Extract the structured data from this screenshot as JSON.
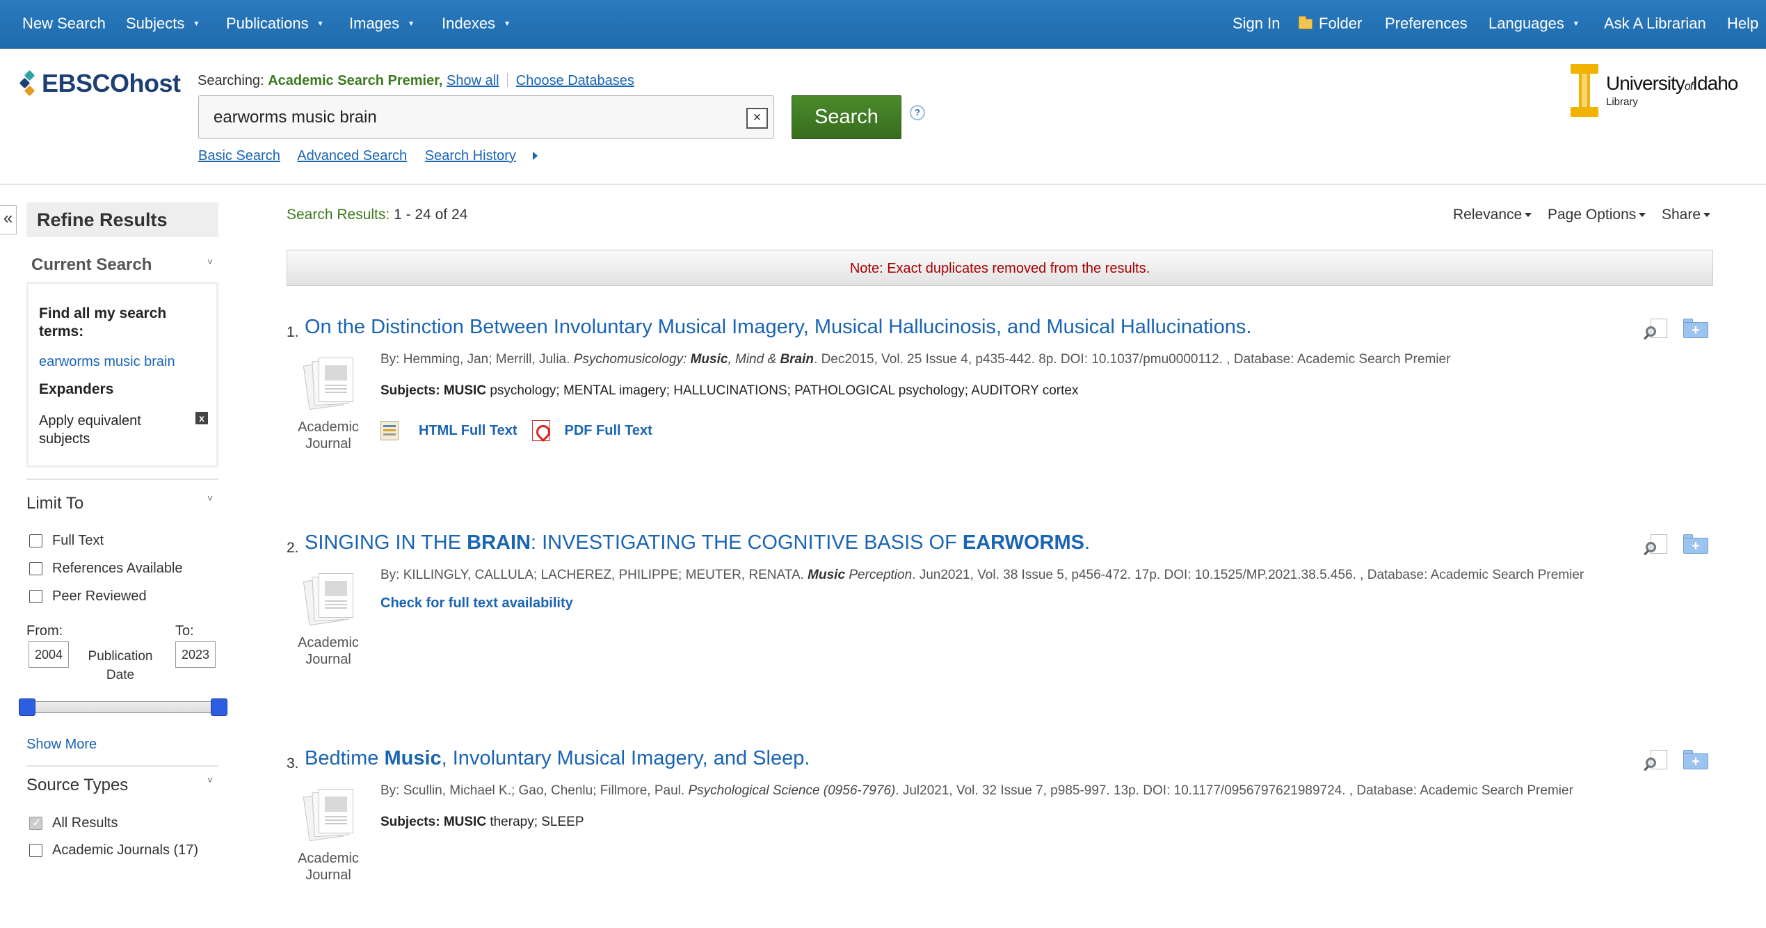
{
  "nav": {
    "new_search": "New Search",
    "subjects": "Subjects",
    "publications": "Publications",
    "images": "Images",
    "indexes": "Indexes",
    "sign_in": "Sign In",
    "folder": "Folder",
    "preferences": "Preferences",
    "languages": "Languages",
    "ask_librarian": "Ask A Librarian",
    "help": "Help"
  },
  "header": {
    "logo": "EBSCOhost",
    "searching_label": "Searching:",
    "database": "Academic Search Premier,",
    "show_all": "Show all",
    "choose_databases": "Choose Databases",
    "search_value": "earworms music brain",
    "clear_label": "×",
    "search_button": "Search",
    "help_label": "?",
    "basic_search": "Basic Search",
    "advanced_search": "Advanced Search",
    "search_history": "Search History",
    "institution_name_a": "University",
    "institution_name_of": "of",
    "institution_name_b": "Idaho",
    "institution_sub": "Library"
  },
  "sidebar": {
    "collapse": "«",
    "refine_results": "Refine Results",
    "current_search": "Current Search",
    "find_all_label": "Find all my search terms:",
    "find_all_value": "earworms music brain",
    "expanders_label": "Expanders",
    "expander_item": "Apply equivalent subjects",
    "expander_remove": "x",
    "limit_to": "Limit To",
    "limits": [
      {
        "label": "Full Text",
        "checked": false
      },
      {
        "label": "References Available",
        "checked": false
      },
      {
        "label": "Peer Reviewed",
        "checked": false
      }
    ],
    "from_label": "From:",
    "to_label": "To:",
    "from_value": "2004",
    "to_value": "2023",
    "publication_date": "Publication Date",
    "show_more": "Show More",
    "source_types": "Source Types",
    "sources": [
      {
        "label": "All Results",
        "checked": true
      },
      {
        "label": "Academic Journals (17)",
        "checked": false
      }
    ]
  },
  "results": {
    "count_label": "Search Results:",
    "count_value": "1 - 24 of 24",
    "relevance": "Relevance",
    "page_options": "Page Options",
    "share": "Share",
    "note": "Note: Exact duplicates removed from the results.",
    "items": [
      {
        "num": "1.",
        "title": "On the Distinction Between Involuntary Musical Imagery, Musical Hallucinosis, and Musical Hallucinations.",
        "authors": "By: Hemming, Jan; Merrill, Julia.",
        "source_a": "Psychomusicology:",
        "source_bold": "Music",
        "source_b": ", Mind &",
        "source_bold2": "Brain",
        "details": ". Dec2015, Vol. 25 Issue 4, p435-442. 8p. DOI: 10.1037/pmu0000112. , Database: Academic Search Premier",
        "subjects_label": "Subjects:",
        "subjects_bold": "MUSIC",
        "subjects_rest": "psychology; MENTAL imagery; HALLUCINATIONS; PATHOLOGICAL psychology; AUDITORY cortex",
        "doc_type": "Academic Journal",
        "html_full_text": "HTML Full Text",
        "pdf_full_text": "PDF Full Text"
      },
      {
        "num": "2.",
        "title_a": "SINGING IN THE",
        "title_bold": "BRAIN",
        "title_b": ": INVESTIGATING THE COGNITIVE BASIS OF",
        "title_bold2": "EARWORMS",
        "title_c": ".",
        "authors": "By: KILLINGLY, CALLULA; LACHEREZ, PHILIPPE; MEUTER, RENATA.",
        "source_bold": "Music",
        "source_a": "Perception",
        "details": ". Jun2021, Vol. 38 Issue 5, p456-472. 17p. DOI: 10.1525/MP.2021.38.5.456. , Database: Academic Search Premier",
        "check_full_text": "Check for full text availability",
        "doc_type": "Academic Journal"
      },
      {
        "num": "3.",
        "title_a": "Bedtime",
        "title_bold": "Music",
        "title_b": ", Involuntary Musical Imagery, and Sleep.",
        "authors": "By: Scullin, Michael K.; Gao, Chenlu; Fillmore, Paul.",
        "source_a": "Psychological Science (0956-7976)",
        "details": ". Jul2021, Vol. 32 Issue 7, p985-997. 13p. DOI: 10.1177/0956797621989724. , Database: Academic Search Premier",
        "subjects_label": "Subjects:",
        "subjects_bold": "MUSIC",
        "subjects_rest": "therapy; SLEEP",
        "doc_type": "Academic Journal"
      }
    ]
  },
  "colors": {
    "nav_bg": "#1f6aab",
    "link": "#1a64b4",
    "search_green": "#3c7a1f",
    "note_red": "#a60000",
    "idaho_gold": "#f1b300"
  },
  "icons": [
    "caret-down-icon",
    "folder-icon",
    "clear-icon",
    "help-icon",
    "triangle-right-icon",
    "chevron-down-icon",
    "document-thumbnail-icon",
    "html-full-text-icon",
    "pdf-icon",
    "preview-icon",
    "add-to-folder-icon"
  ]
}
